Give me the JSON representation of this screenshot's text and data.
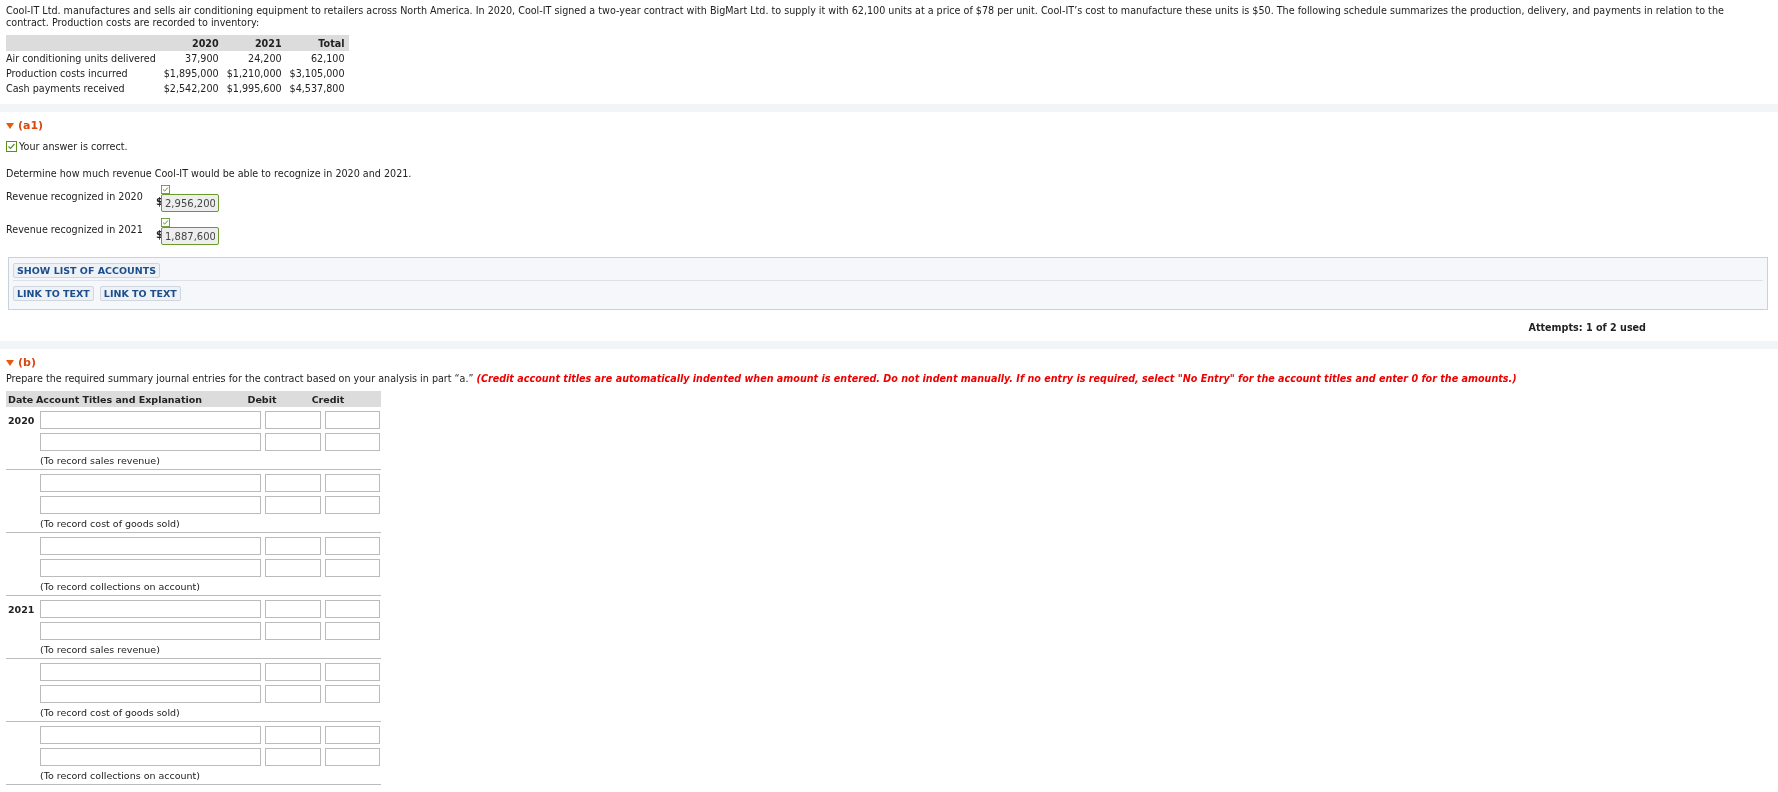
{
  "intro": "Cool-IT Ltd. manufactures and sells air conditioning equipment to retailers across North America. In 2020, Cool-IT signed a two-year contract with BigMart Ltd. to supply it with 62,100 units at a price of $78 per unit. Cool-IT’s cost to manufacture these units is $50. The following schedule summarizes the production, delivery, and payments in relation to the contract. Production costs are recorded to inventory:",
  "schedule": {
    "columns": [
      "2020",
      "2021",
      "Total"
    ],
    "rows": [
      {
        "label": "Air conditioning units delivered",
        "values": [
          "37,900",
          "24,200",
          "62,100"
        ]
      },
      {
        "label": "Production costs incurred",
        "values": [
          "$1,895,000",
          "$1,210,000",
          "$3,105,000"
        ]
      },
      {
        "label": "Cash payments received",
        "values": [
          "$2,542,200",
          "$1,995,600",
          "$4,537,800"
        ]
      }
    ]
  },
  "part_a1": {
    "label": "(a1)",
    "status": {
      "text": "Your answer is correct.",
      "correct": true
    },
    "question": "Determine how much revenue Cool-IT would be able to recognize in 2020 and 2021.",
    "answers": [
      {
        "label": "Revenue recognized in 2020",
        "currency": "$",
        "value": "2,956,200",
        "correct": true
      },
      {
        "label": "Revenue recognized in 2021",
        "currency": "$",
        "value": "1,887,600",
        "correct": true
      }
    ],
    "buttons": [
      "SHOW LIST OF ACCOUNTS"
    ],
    "links": [
      "LINK TO TEXT",
      "LINK TO TEXT"
    ],
    "attempts": "Attempts: 1 of 2 used"
  },
  "part_b": {
    "label": "(b)",
    "instruction": "Prepare the required summary journal entries for the contract based on your analysis in part “a.”",
    "note": "(Credit account titles are automatically indented when amount is entered. Do not indent manually. If no entry is required, select \"No Entry\" for the account titles and enter 0 for the amounts.)",
    "columns": [
      "Date",
      "Account Titles and Explanation",
      "Debit",
      "Credit"
    ],
    "entries": [
      {
        "date": "2020",
        "explanation": "(To record sales revenue)"
      },
      {
        "explanation": "(To record cost of goods sold)"
      },
      {
        "explanation": "(To record collections on account)"
      },
      {
        "date": "2021",
        "explanation": "(To record sales revenue)"
      },
      {
        "explanation": "(To record cost of goods sold)"
      },
      {
        "explanation": "(To record collections on account)"
      }
    ]
  }
}
